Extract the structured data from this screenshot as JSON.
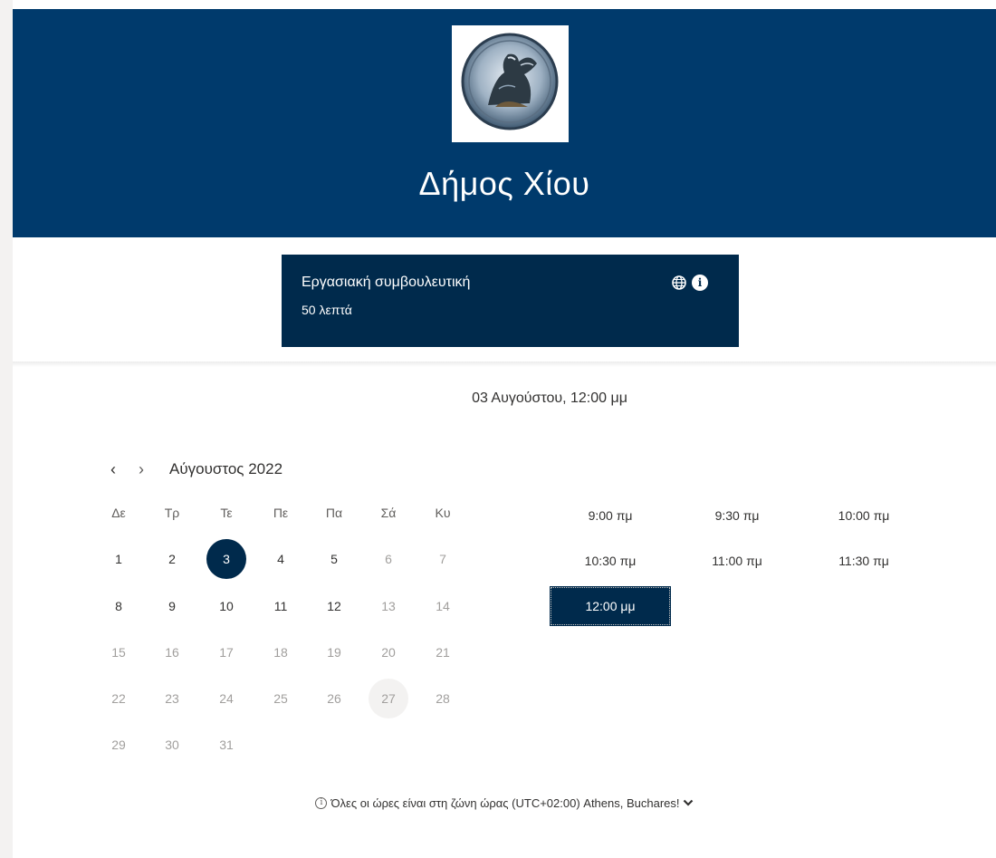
{
  "header": {
    "org_name": "Δήμος Χίου",
    "logo_icon": "sphinx-seal-logo",
    "background": "#003a6c"
  },
  "service": {
    "title": "Εργασιακή συμβουλευτική",
    "duration": "50 λεπτά",
    "icons": [
      "globe-icon",
      "info-icon"
    ],
    "info_glyph": "i"
  },
  "selection_summary": "03 Αυγούστου, 12:00 μμ",
  "calendar": {
    "prev_glyph": "‹",
    "next_glyph": "›",
    "month_label": "Αύγουστος 2022",
    "weekdays": [
      "Δε",
      "Τρ",
      "Τε",
      "Πε",
      "Πα",
      "Σά",
      "Κυ"
    ],
    "selected_day": "3",
    "today_day": "27",
    "days": [
      {
        "n": "1",
        "enabled": true
      },
      {
        "n": "2",
        "enabled": true
      },
      {
        "n": "3",
        "enabled": true
      },
      {
        "n": "4",
        "enabled": true
      },
      {
        "n": "5",
        "enabled": true
      },
      {
        "n": "6",
        "enabled": false
      },
      {
        "n": "7",
        "enabled": false
      },
      {
        "n": "8",
        "enabled": true
      },
      {
        "n": "9",
        "enabled": true
      },
      {
        "n": "10",
        "enabled": true
      },
      {
        "n": "11",
        "enabled": true
      },
      {
        "n": "12",
        "enabled": true
      },
      {
        "n": "13",
        "enabled": false
      },
      {
        "n": "14",
        "enabled": false
      },
      {
        "n": "15",
        "enabled": false
      },
      {
        "n": "16",
        "enabled": false
      },
      {
        "n": "17",
        "enabled": false
      },
      {
        "n": "18",
        "enabled": false
      },
      {
        "n": "19",
        "enabled": false
      },
      {
        "n": "20",
        "enabled": false
      },
      {
        "n": "21",
        "enabled": false
      },
      {
        "n": "22",
        "enabled": false
      },
      {
        "n": "23",
        "enabled": false
      },
      {
        "n": "24",
        "enabled": false
      },
      {
        "n": "25",
        "enabled": false
      },
      {
        "n": "26",
        "enabled": false
      },
      {
        "n": "27",
        "enabled": false
      },
      {
        "n": "28",
        "enabled": false
      },
      {
        "n": "29",
        "enabled": false
      },
      {
        "n": "30",
        "enabled": false
      },
      {
        "n": "31",
        "enabled": false
      }
    ]
  },
  "time_slots": {
    "selected": "12:00 μμ",
    "slots": [
      "9:00 πμ",
      "9:30 πμ",
      "10:00 πμ",
      "10:30 πμ",
      "11:00 πμ",
      "11:30 πμ",
      "12:00 μμ"
    ]
  },
  "timezone": {
    "info_glyph": "i",
    "text": "Όλες οι ώρες είναι στη ζώνη ώρας  (UTC+02:00) Athens, Buchares!",
    "chevron_glyph": "⌄"
  },
  "colors": {
    "accent": "#002a4c",
    "disabled_text": "#a19f9d",
    "today_bg": "#f3f2f1"
  }
}
